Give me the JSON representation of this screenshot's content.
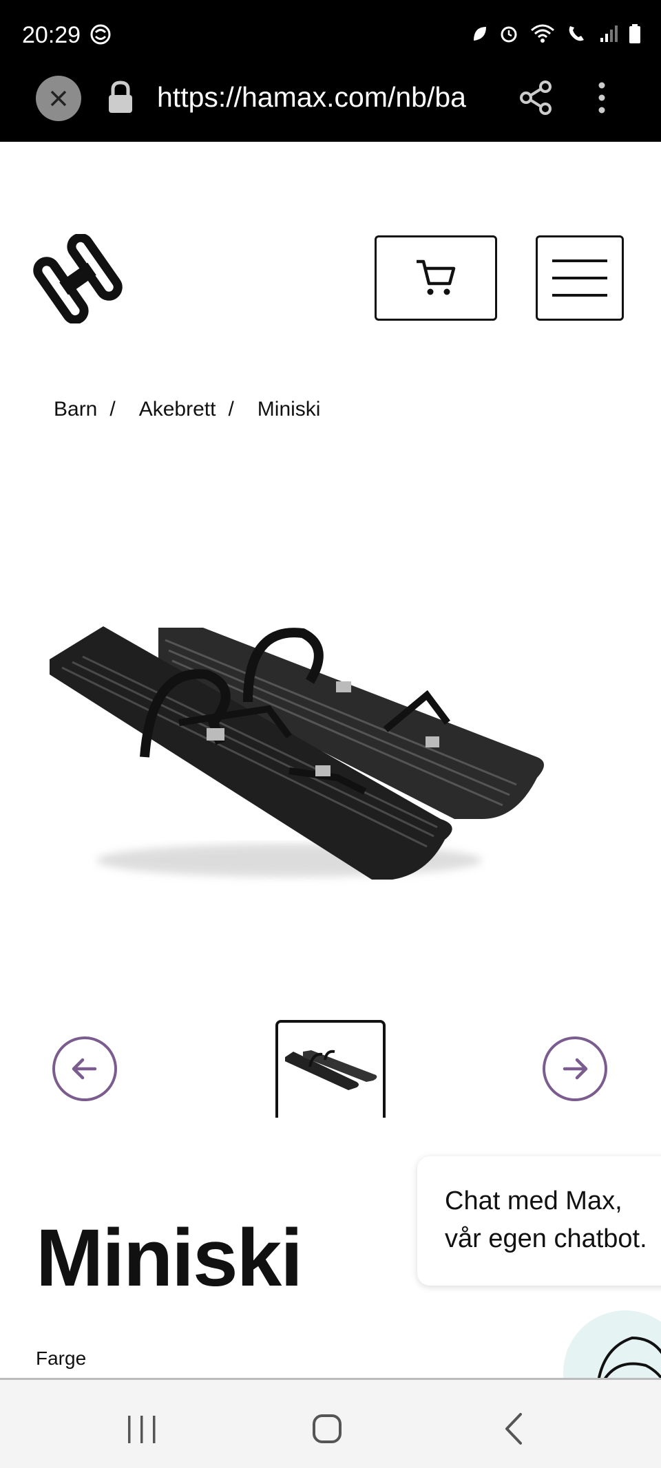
{
  "status_bar": {
    "time": "20:29"
  },
  "browser": {
    "url": "https://hamax.com/nb/ba"
  },
  "breadcrumb": {
    "items": [
      "Barn",
      "Akebrett",
      "Miniski"
    ],
    "separator": "/"
  },
  "product": {
    "title": "Miniski",
    "color_label": "Farge"
  },
  "chat": {
    "line1": "Chat med Max,",
    "line2": "vår egen chatbot."
  },
  "colors": {
    "accent": "#7a5c8e",
    "text": "#111111",
    "topbar": "#000000"
  }
}
